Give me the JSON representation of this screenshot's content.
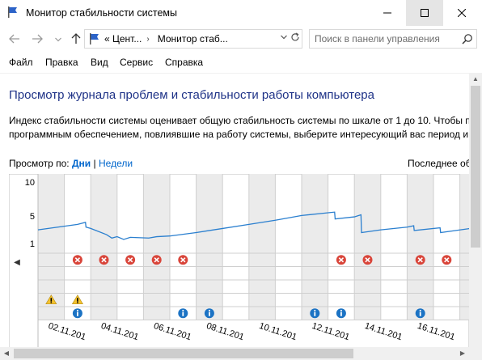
{
  "window": {
    "title": "Монитор стабильности системы",
    "minimize_glyph": "—",
    "maximize_glyph": "☐",
    "close_glyph": "✕"
  },
  "address": {
    "crumb_1": "« Цент...",
    "separator": "›",
    "crumb_2": "Монитор стаб...",
    "search_placeholder": "Поиск в панели управления"
  },
  "menu": {
    "items": [
      "Файл",
      "Правка",
      "Вид",
      "Сервис",
      "Справка"
    ]
  },
  "content": {
    "heading": "Просмотр журнала проблем и стабильности работы компьютера",
    "desc_line1": "Индекс стабильности системы оценивает общую стабильность системы по шкале от 1 до 10. Чтобы п",
    "desc_line2": "программным обеспечением, повлиявшие на работу системы, выберите интересующий вас период и",
    "view_by_label": "Просмотр по:",
    "view_days": "Дни",
    "view_sep": "|",
    "view_weeks": "Недели",
    "last_label": "Последнее об"
  },
  "chart_data": {
    "type": "line",
    "title": "",
    "xlabel": "",
    "ylabel": "",
    "y_ticks": [
      "10",
      "5",
      "1"
    ],
    "ylim": [
      1,
      10
    ],
    "grid": true,
    "columns": 17,
    "shaded_columns": [
      0,
      2,
      4,
      6,
      8,
      10,
      12,
      14,
      16
    ],
    "date_labels": [
      {
        "col": 0,
        "text": "02.11.201"
      },
      {
        "col": 2,
        "text": "04.11.201"
      },
      {
        "col": 4,
        "text": "06.11.201"
      },
      {
        "col": 6,
        "text": "08.11.201"
      },
      {
        "col": 8,
        "text": "10.11.201"
      },
      {
        "col": 10,
        "text": "12.11.201"
      },
      {
        "col": 12,
        "text": "14.11.201"
      },
      {
        "col": 14,
        "text": "16.11.201"
      }
    ],
    "stability_index": [
      {
        "x": 0,
        "y": 3.0
      },
      {
        "x": 1.5,
        "y": 3.8
      },
      {
        "x": 1.8,
        "y": 4.1
      },
      {
        "x": 1.82,
        "y": 3.4
      },
      {
        "x": 2.0,
        "y": 3.2
      },
      {
        "x": 2.6,
        "y": 2.3
      },
      {
        "x": 2.8,
        "y": 1.8
      },
      {
        "x": 3.0,
        "y": 2.0
      },
      {
        "x": 3.25,
        "y": 1.6
      },
      {
        "x": 3.5,
        "y": 1.9
      },
      {
        "x": 4.2,
        "y": 1.8
      },
      {
        "x": 4.5,
        "y": 2.0
      },
      {
        "x": 5.0,
        "y": 2.1
      },
      {
        "x": 6.0,
        "y": 2.6
      },
      {
        "x": 7.0,
        "y": 3.2
      },
      {
        "x": 8.0,
        "y": 3.8
      },
      {
        "x": 9.0,
        "y": 4.4
      },
      {
        "x": 10.0,
        "y": 5.1
      },
      {
        "x": 11.25,
        "y": 5.6
      },
      {
        "x": 11.27,
        "y": 4.6
      },
      {
        "x": 12.0,
        "y": 4.9
      },
      {
        "x": 12.25,
        "y": 5.2
      },
      {
        "x": 12.27,
        "y": 2.6
      },
      {
        "x": 13.0,
        "y": 3.0
      },
      {
        "x": 14.0,
        "y": 3.4
      },
      {
        "x": 14.25,
        "y": 3.6
      },
      {
        "x": 14.27,
        "y": 2.9
      },
      {
        "x": 15.25,
        "y": 3.3
      },
      {
        "x": 15.27,
        "y": 2.6
      },
      {
        "x": 16.4,
        "y": 3.2
      }
    ],
    "rows": [
      "critical",
      "row2",
      "row3",
      "warning",
      "information"
    ],
    "events": [
      {
        "row": "critical",
        "cols": [
          1,
          2,
          3,
          4,
          5,
          11,
          12,
          14,
          15
        ],
        "icon": "error-icon",
        "color": "#d9453a"
      },
      {
        "row": "warning",
        "cols": [
          0,
          1
        ],
        "icon": "warning-icon",
        "color": "#f3c22f"
      },
      {
        "row": "information",
        "cols": [
          1,
          5,
          6,
          10,
          11,
          14
        ],
        "icon": "info-icon",
        "color": "#1c73c4"
      }
    ],
    "line_color": "#2a7fcf"
  }
}
